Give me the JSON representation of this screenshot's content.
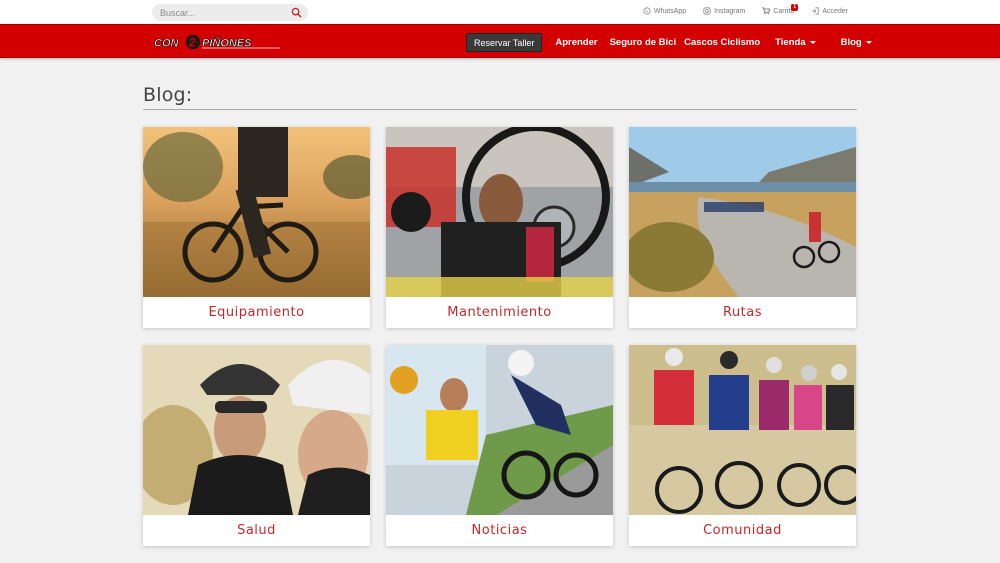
{
  "search": {
    "placeholder": "Buscar..."
  },
  "toplinks": {
    "whatsapp": "WhatsApp",
    "instagram": "Instagram",
    "cart": "Carrito",
    "cart_count": "1",
    "login": "Acceder"
  },
  "brand": {
    "logo_text": "CON2PIÑONES",
    "accent": "#d20000"
  },
  "nav": {
    "reserve_label": "Reservar Taller",
    "items": [
      "Aprender",
      "Seguro de Bici",
      "Cascos Ciclismo",
      "Tienda",
      "Blog"
    ]
  },
  "page": {
    "title": "Blog:"
  },
  "cards": [
    {
      "label": "Equipamiento"
    },
    {
      "label": "Mantenimiento"
    },
    {
      "label": "Rutas"
    },
    {
      "label": "Salud"
    },
    {
      "label": "Noticias"
    },
    {
      "label": "Comunidad"
    }
  ]
}
